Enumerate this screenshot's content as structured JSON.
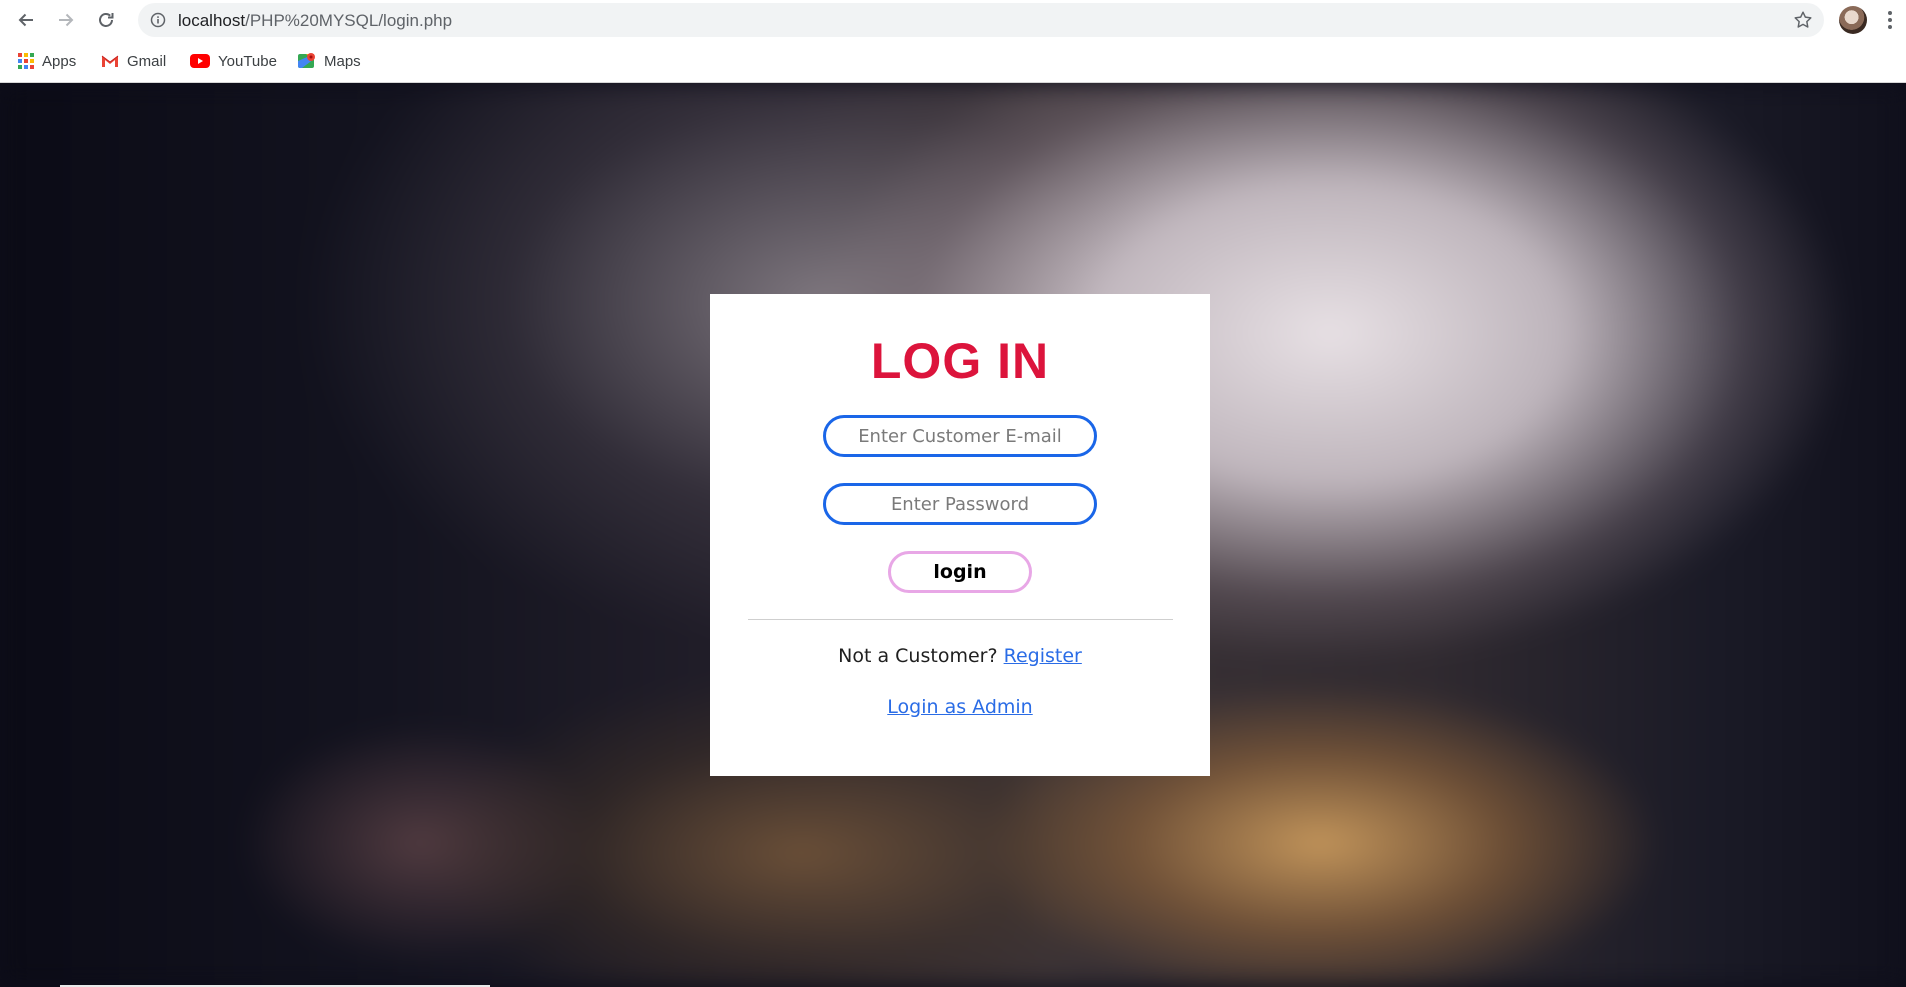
{
  "browser": {
    "url_host": "localhost",
    "url_path": "/PHP%20MYSQL/login.php",
    "icons": {
      "back": "arrow-left-icon",
      "forward": "arrow-right-icon",
      "reload": "reload-icon",
      "info": "info-icon",
      "bookmark_star": "star-icon",
      "menu": "more-vert-icon"
    },
    "bookmarks": [
      {
        "label": "Apps",
        "icon": "apps-grid-icon"
      },
      {
        "label": "Gmail",
        "icon": "gmail-icon"
      },
      {
        "label": "YouTube",
        "icon": "youtube-icon"
      },
      {
        "label": "Maps",
        "icon": "maps-icon"
      }
    ]
  },
  "login": {
    "title": "LOG IN",
    "email_placeholder": "Enter Customer E-mail",
    "password_placeholder": "Enter Password",
    "submit_label": "login",
    "register_prompt": "Not a Customer?",
    "register_link": "Register",
    "admin_link": "Login as Admin"
  },
  "colors": {
    "title": "#dc143c",
    "input_border": "#1a66e8",
    "button_border": "#e8a7e6",
    "link": "#2a6ce6"
  }
}
